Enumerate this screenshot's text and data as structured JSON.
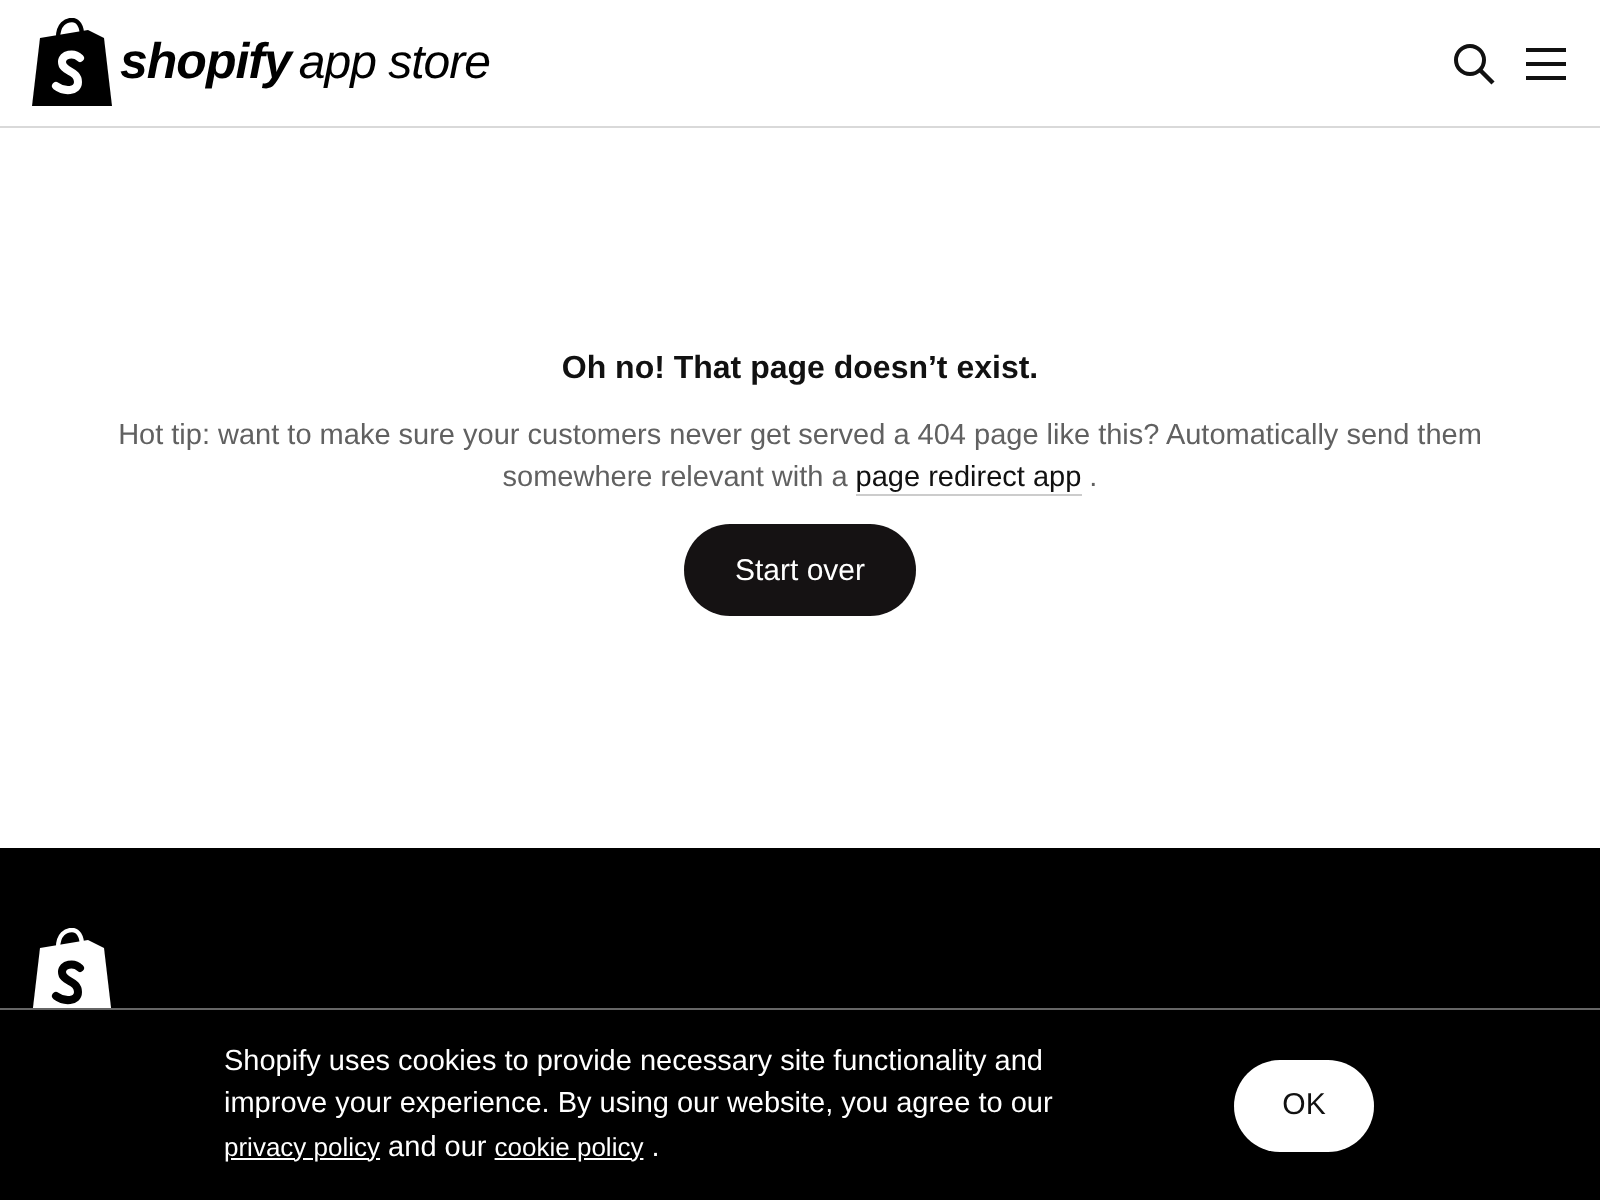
{
  "header": {
    "logo": {
      "brand": "shopify",
      "suffix": "app store"
    }
  },
  "main": {
    "heading": "Oh no! That page doesn’t exist.",
    "tip": [
      {
        "kind": "text",
        "text": "Hot tip: want to make sure your customers never get served a 404 page like this? Automatically send them somewhere relevant with a "
      },
      {
        "kind": "link",
        "text": "page redirect app"
      },
      {
        "kind": "text",
        "text": " ."
      }
    ],
    "button": "Start over"
  },
  "cookie_banner": {
    "message": [
      {
        "kind": "text",
        "text": "Shopify uses cookies to provide necessary site functionality and improve your experience. By using our website, you agree to our "
      },
      {
        "kind": "link",
        "text": "privacy policy"
      },
      {
        "kind": "text",
        "text": " and our "
      },
      {
        "kind": "link",
        "text": "cookie policy"
      },
      {
        "kind": "text",
        "text": " ."
      }
    ],
    "button": "OK"
  }
}
